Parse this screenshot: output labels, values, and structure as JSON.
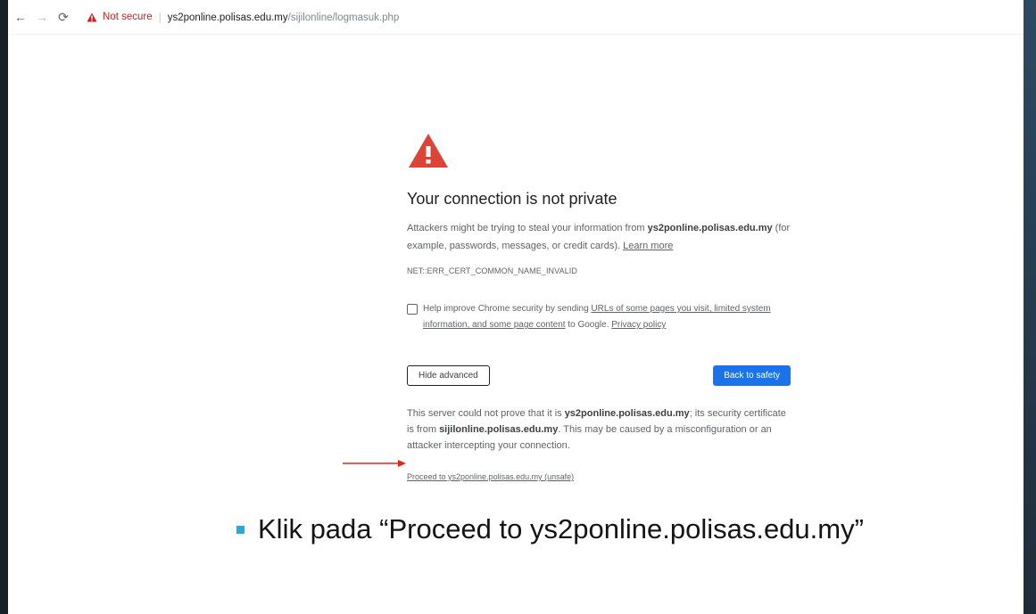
{
  "browser": {
    "toolbar": {
      "not_secure_label": "Not secure",
      "separator": "|",
      "url_host": "ys2ponline.polisas.edu.my",
      "url_path": "/sijilonline/logmasuk.php"
    }
  },
  "interstitial": {
    "heading": "Your connection is not private",
    "intro": {
      "pre": "Attackers might be trying to steal your information from ",
      "host": "ys2ponline.polisas.edu.my",
      "post": " (for example, passwords, messages, or credit cards). ",
      "learn_more": "Learn more"
    },
    "error_code": "NET::ERR_CERT_COMMON_NAME_INVALID",
    "optin": {
      "pre": "Help improve Chrome security by sending ",
      "link": "URLs of some pages you visit, limited system information, and some page content",
      "mid": " to Google. ",
      "privacy": "Privacy policy"
    },
    "hide_advanced": "Hide advanced",
    "back_to_safety": "Back to safety",
    "details": {
      "pre": "This server could not prove that it is ",
      "host": "ys2ponline.polisas.edu.my",
      "mid": "; its security certificate is from ",
      "cert_host": "sijilonline.polisas.edu.my",
      "post": ". This may be caused by a misconfiguration or an attacker intercepting your connection."
    },
    "proceed_link": "Proceed to ys2ponline.polisas.edu.my (unsafe)"
  },
  "caption": "Klik pada “Proceed to ys2ponline.polisas.edu.my”",
  "colors": {
    "warning_red": "#db4437",
    "primary_blue": "#1a73e8",
    "annotation_arrow": "#e0251b",
    "bullet": "#29a8e0"
  }
}
